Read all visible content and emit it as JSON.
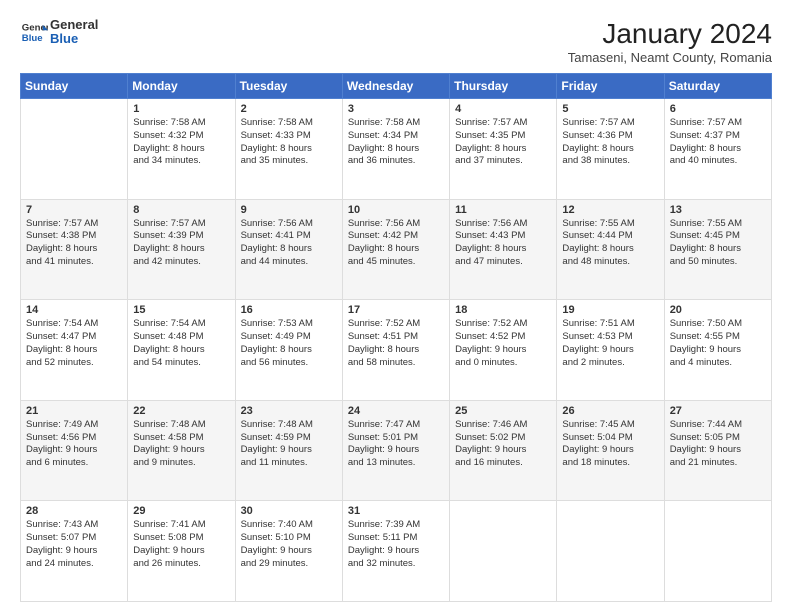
{
  "header": {
    "logo_general": "General",
    "logo_blue": "Blue",
    "title": "January 2024",
    "subtitle": "Tamaseni, Neamt County, Romania"
  },
  "days_of_week": [
    "Sunday",
    "Monday",
    "Tuesday",
    "Wednesday",
    "Thursday",
    "Friday",
    "Saturday"
  ],
  "weeks": [
    [
      {
        "day": "",
        "info": ""
      },
      {
        "day": "1",
        "info": "Sunrise: 7:58 AM\nSunset: 4:32 PM\nDaylight: 8 hours\nand 34 minutes."
      },
      {
        "day": "2",
        "info": "Sunrise: 7:58 AM\nSunset: 4:33 PM\nDaylight: 8 hours\nand 35 minutes."
      },
      {
        "day": "3",
        "info": "Sunrise: 7:58 AM\nSunset: 4:34 PM\nDaylight: 8 hours\nand 36 minutes."
      },
      {
        "day": "4",
        "info": "Sunrise: 7:57 AM\nSunset: 4:35 PM\nDaylight: 8 hours\nand 37 minutes."
      },
      {
        "day": "5",
        "info": "Sunrise: 7:57 AM\nSunset: 4:36 PM\nDaylight: 8 hours\nand 38 minutes."
      },
      {
        "day": "6",
        "info": "Sunrise: 7:57 AM\nSunset: 4:37 PM\nDaylight: 8 hours\nand 40 minutes."
      }
    ],
    [
      {
        "day": "7",
        "info": "Sunrise: 7:57 AM\nSunset: 4:38 PM\nDaylight: 8 hours\nand 41 minutes."
      },
      {
        "day": "8",
        "info": "Sunrise: 7:57 AM\nSunset: 4:39 PM\nDaylight: 8 hours\nand 42 minutes."
      },
      {
        "day": "9",
        "info": "Sunrise: 7:56 AM\nSunset: 4:41 PM\nDaylight: 8 hours\nand 44 minutes."
      },
      {
        "day": "10",
        "info": "Sunrise: 7:56 AM\nSunset: 4:42 PM\nDaylight: 8 hours\nand 45 minutes."
      },
      {
        "day": "11",
        "info": "Sunrise: 7:56 AM\nSunset: 4:43 PM\nDaylight: 8 hours\nand 47 minutes."
      },
      {
        "day": "12",
        "info": "Sunrise: 7:55 AM\nSunset: 4:44 PM\nDaylight: 8 hours\nand 48 minutes."
      },
      {
        "day": "13",
        "info": "Sunrise: 7:55 AM\nSunset: 4:45 PM\nDaylight: 8 hours\nand 50 minutes."
      }
    ],
    [
      {
        "day": "14",
        "info": "Sunrise: 7:54 AM\nSunset: 4:47 PM\nDaylight: 8 hours\nand 52 minutes."
      },
      {
        "day": "15",
        "info": "Sunrise: 7:54 AM\nSunset: 4:48 PM\nDaylight: 8 hours\nand 54 minutes."
      },
      {
        "day": "16",
        "info": "Sunrise: 7:53 AM\nSunset: 4:49 PM\nDaylight: 8 hours\nand 56 minutes."
      },
      {
        "day": "17",
        "info": "Sunrise: 7:52 AM\nSunset: 4:51 PM\nDaylight: 8 hours\nand 58 minutes."
      },
      {
        "day": "18",
        "info": "Sunrise: 7:52 AM\nSunset: 4:52 PM\nDaylight: 9 hours\nand 0 minutes."
      },
      {
        "day": "19",
        "info": "Sunrise: 7:51 AM\nSunset: 4:53 PM\nDaylight: 9 hours\nand 2 minutes."
      },
      {
        "day": "20",
        "info": "Sunrise: 7:50 AM\nSunset: 4:55 PM\nDaylight: 9 hours\nand 4 minutes."
      }
    ],
    [
      {
        "day": "21",
        "info": "Sunrise: 7:49 AM\nSunset: 4:56 PM\nDaylight: 9 hours\nand 6 minutes."
      },
      {
        "day": "22",
        "info": "Sunrise: 7:48 AM\nSunset: 4:58 PM\nDaylight: 9 hours\nand 9 minutes."
      },
      {
        "day": "23",
        "info": "Sunrise: 7:48 AM\nSunset: 4:59 PM\nDaylight: 9 hours\nand 11 minutes."
      },
      {
        "day": "24",
        "info": "Sunrise: 7:47 AM\nSunset: 5:01 PM\nDaylight: 9 hours\nand 13 minutes."
      },
      {
        "day": "25",
        "info": "Sunrise: 7:46 AM\nSunset: 5:02 PM\nDaylight: 9 hours\nand 16 minutes."
      },
      {
        "day": "26",
        "info": "Sunrise: 7:45 AM\nSunset: 5:04 PM\nDaylight: 9 hours\nand 18 minutes."
      },
      {
        "day": "27",
        "info": "Sunrise: 7:44 AM\nSunset: 5:05 PM\nDaylight: 9 hours\nand 21 minutes."
      }
    ],
    [
      {
        "day": "28",
        "info": "Sunrise: 7:43 AM\nSunset: 5:07 PM\nDaylight: 9 hours\nand 24 minutes."
      },
      {
        "day": "29",
        "info": "Sunrise: 7:41 AM\nSunset: 5:08 PM\nDaylight: 9 hours\nand 26 minutes."
      },
      {
        "day": "30",
        "info": "Sunrise: 7:40 AM\nSunset: 5:10 PM\nDaylight: 9 hours\nand 29 minutes."
      },
      {
        "day": "31",
        "info": "Sunrise: 7:39 AM\nSunset: 5:11 PM\nDaylight: 9 hours\nand 32 minutes."
      },
      {
        "day": "",
        "info": ""
      },
      {
        "day": "",
        "info": ""
      },
      {
        "day": "",
        "info": ""
      }
    ]
  ]
}
